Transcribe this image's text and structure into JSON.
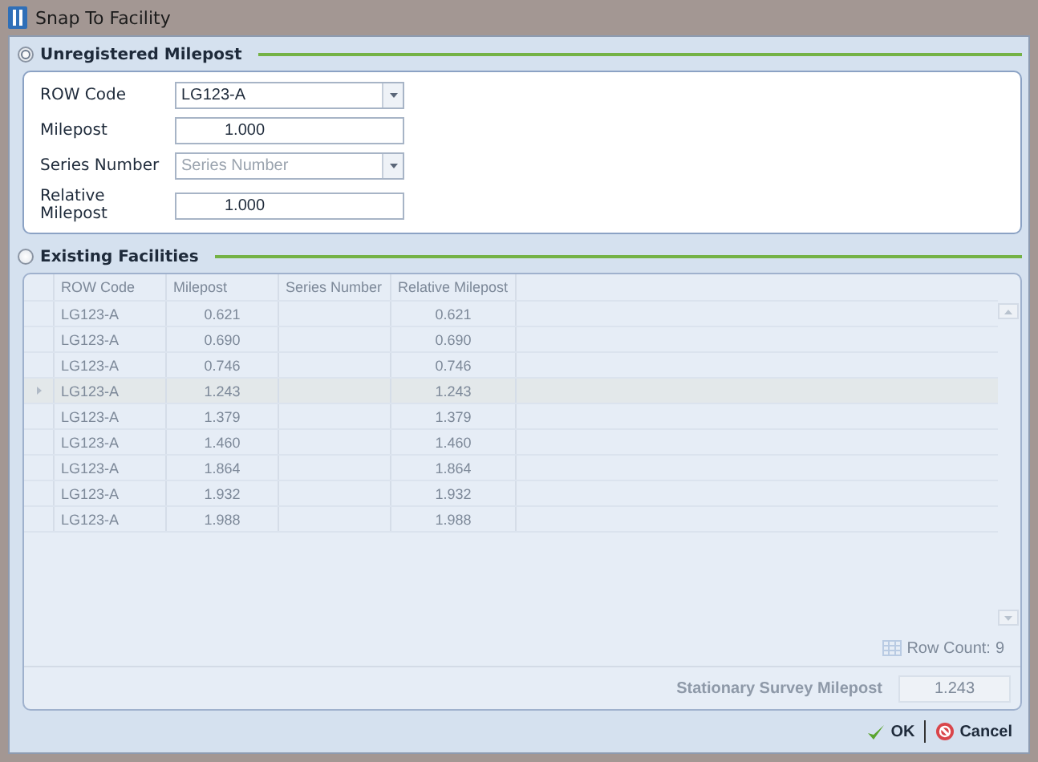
{
  "window": {
    "title": "Snap To Facility"
  },
  "unregistered": {
    "title": "Unregistered Milepost",
    "selected": true,
    "fields": [
      {
        "label": "ROW Code",
        "kind": "dropdown",
        "value": "LG123-A"
      },
      {
        "label": "Milepost",
        "kind": "number",
        "value": "1.000"
      },
      {
        "label": "Series Number",
        "kind": "dropdown",
        "placeholder": "Series Number"
      },
      {
        "label": "Relative Milepost",
        "kind": "number",
        "value": "1.000"
      }
    ]
  },
  "existing": {
    "title": "Existing Facilities",
    "selected": false,
    "table": {
      "columns": [
        "ROW Code",
        "Milepost",
        "Series Number",
        "Relative Milepost"
      ],
      "rows": [
        {
          "cells": [
            "LG123-A",
            "0.621",
            "",
            "0.621"
          ],
          "selected": false
        },
        {
          "cells": [
            "LG123-A",
            "0.690",
            "",
            "0.690"
          ],
          "selected": false
        },
        {
          "cells": [
            "LG123-A",
            "0.746",
            "",
            "0.746"
          ],
          "selected": false
        },
        {
          "cells": [
            "LG123-A",
            "1.243",
            "",
            "1.243"
          ],
          "selected": true
        },
        {
          "cells": [
            "LG123-A",
            "1.379",
            "",
            "1.379"
          ],
          "selected": false
        },
        {
          "cells": [
            "LG123-A",
            "1.460",
            "",
            "1.460"
          ],
          "selected": false
        },
        {
          "cells": [
            "LG123-A",
            "1.864",
            "",
            "1.864"
          ],
          "selected": false
        },
        {
          "cells": [
            "LG123-A",
            "1.932",
            "",
            "1.932"
          ],
          "selected": false
        },
        {
          "cells": [
            "LG123-A",
            "1.988",
            "",
            "1.988"
          ],
          "selected": false
        }
      ]
    },
    "row_count_label": "Row Count:",
    "row_count": "9",
    "stationary_label": "Stationary Survey Milepost",
    "stationary_value": "1.243"
  },
  "buttons": [
    {
      "label": "OK",
      "kind": "ok"
    },
    {
      "label": "Cancel",
      "kind": "cancel"
    }
  ]
}
